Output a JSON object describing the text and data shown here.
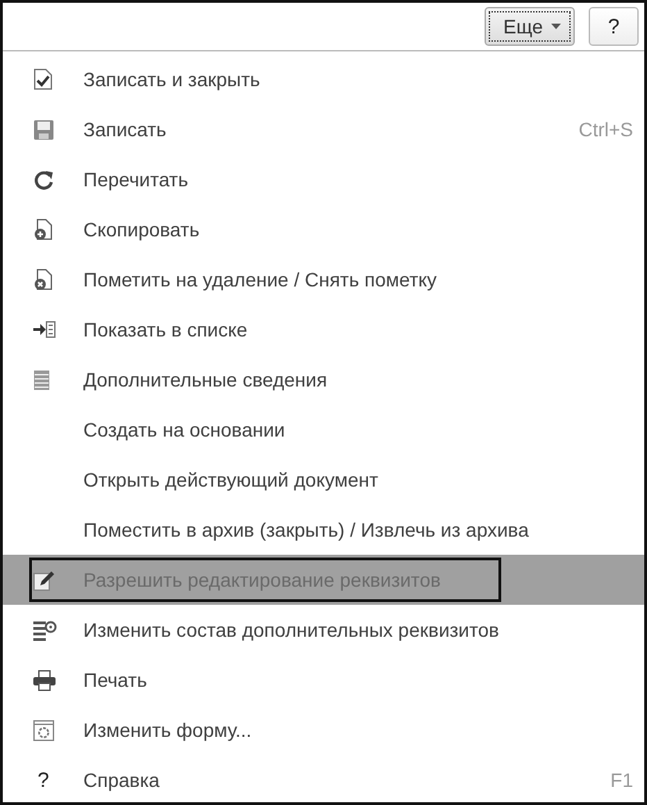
{
  "toolbar": {
    "more_button": "Еще",
    "help_button": "?"
  },
  "menu": [
    {
      "kind": "doc-check",
      "label": "Записать и закрыть",
      "selected": false
    },
    {
      "kind": "floppy",
      "label": "Записать",
      "shortcut": "Ctrl+S",
      "selected": false
    },
    {
      "kind": "refresh",
      "label": "Перечитать",
      "selected": false
    },
    {
      "kind": "doc-plus",
      "label": "Скопировать",
      "selected": false
    },
    {
      "kind": "doc-x",
      "label": "Пометить на удаление / Снять пометку",
      "selected": false
    },
    {
      "kind": "list-arrow",
      "label": "Показать в списке",
      "selected": false
    },
    {
      "kind": "lines",
      "label": "Дополнительные сведения",
      "selected": false
    },
    {
      "label": "Создать на основании",
      "selected": false
    },
    {
      "label": "Открыть действующий документ",
      "selected": false
    },
    {
      "label": "Поместить в архив (закрыть) / Извлечь из архива",
      "selected": false
    },
    {
      "kind": "pencil",
      "label": "Разрешить редактирование реквизитов",
      "selected": true
    },
    {
      "kind": "list-gear",
      "label": "Изменить состав дополнительных реквизитов",
      "selected": false
    },
    {
      "kind": "printer",
      "label": "Печать",
      "selected": false
    },
    {
      "kind": "window-gear",
      "label": "Изменить форму...",
      "selected": false
    },
    {
      "kind": "glyph",
      "glyph": "?",
      "label": "Справка",
      "shortcut": "F1",
      "selected": false
    }
  ]
}
